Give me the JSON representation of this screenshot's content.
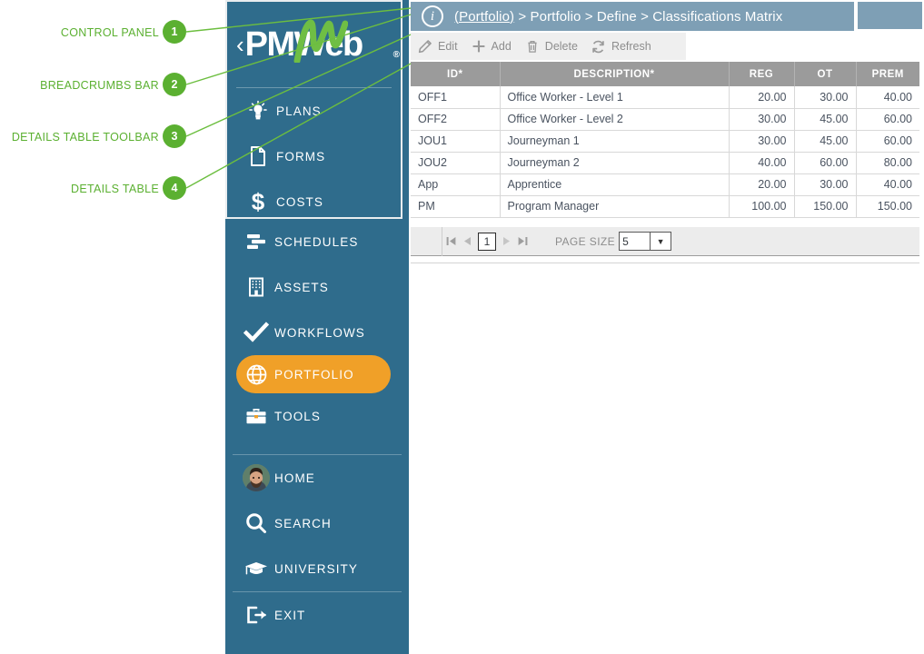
{
  "annotations": [
    {
      "label": "CONTROL PANEL",
      "number": "1"
    },
    {
      "label": "BREADCRUMBS BAR",
      "number": "2"
    },
    {
      "label": "DETAILS TABLE TOOLBAR",
      "number": "3"
    },
    {
      "label": "DETAILS TABLE",
      "number": "4"
    }
  ],
  "colors": {
    "sidebar": "#2f6c8c",
    "accent": "#f0a028",
    "annotation_green": "#5bb031",
    "breadcrumb_bar": "#7e9fb5",
    "table_header": "#9b9b9b"
  },
  "sidebar": {
    "logo": {
      "text_pm": "PM",
      "text_web": "Web",
      "registered": "®",
      "collapse_icon": "‹"
    },
    "group_primary": [
      {
        "label": "PLANS",
        "icon": "lightbulb-icon"
      },
      {
        "label": "FORMS",
        "icon": "document-icon"
      },
      {
        "label": "COSTS",
        "icon": "dollar-icon"
      }
    ],
    "group_modules": [
      {
        "label": "SCHEDULES",
        "icon": "gantt-icon",
        "active": false
      },
      {
        "label": "ASSETS",
        "icon": "building-icon",
        "active": false
      },
      {
        "label": "WORKFLOWS",
        "icon": "check-icon",
        "active": false
      },
      {
        "label": "PORTFOLIO",
        "icon": "globe-icon",
        "active": true
      },
      {
        "label": "TOOLS",
        "icon": "toolbox-icon",
        "active": false
      }
    ],
    "group_utility": [
      {
        "label": "HOME",
        "icon": "avatar-icon"
      },
      {
        "label": "SEARCH",
        "icon": "search-icon"
      },
      {
        "label": "UNIVERSITY",
        "icon": "graduation-cap-icon"
      }
    ],
    "group_exit": [
      {
        "label": "EXIT",
        "icon": "exit-icon"
      }
    ]
  },
  "breadcrumb": {
    "info_icon": "i",
    "root_link": "(Portfolio)",
    "sep1": " > ",
    "part2": "Portfolio",
    "sep2": " > ",
    "part3": "Define",
    "sep3": " > ",
    "part4": "Classifications Matrix"
  },
  "toolbar": {
    "edit_label": "Edit",
    "add_label": "Add",
    "delete_label": "Delete",
    "refresh_label": "Refresh"
  },
  "table": {
    "columns": [
      "ID*",
      "DESCRIPTION*",
      "REG",
      "OT",
      "PREM"
    ],
    "rows": [
      {
        "id": "OFF1",
        "description": "Office Worker - Level 1",
        "reg": "20.00",
        "ot": "30.00",
        "prem": "40.00"
      },
      {
        "id": "OFF2",
        "description": "Office Worker - Level 2",
        "reg": "30.00",
        "ot": "45.00",
        "prem": "60.00"
      },
      {
        "id": "JOU1",
        "description": "Journeyman 1",
        "reg": "30.00",
        "ot": "45.00",
        "prem": "60.00"
      },
      {
        "id": "JOU2",
        "description": "Journeyman 2",
        "reg": "40.00",
        "ot": "60.00",
        "prem": "80.00"
      },
      {
        "id": "App",
        "description": "Apprentice",
        "reg": "20.00",
        "ot": "30.00",
        "prem": "40.00"
      },
      {
        "id": "PM",
        "description": "Program Manager",
        "reg": "100.00",
        "ot": "150.00",
        "prem": "150.00"
      }
    ]
  },
  "pager": {
    "first": "⏮",
    "prev": "◀",
    "page_number": "1",
    "next": "▶",
    "last": "⏭",
    "page_size_label": "PAGE SIZE",
    "page_size_value": "5",
    "dropdown_icon": "▼"
  }
}
